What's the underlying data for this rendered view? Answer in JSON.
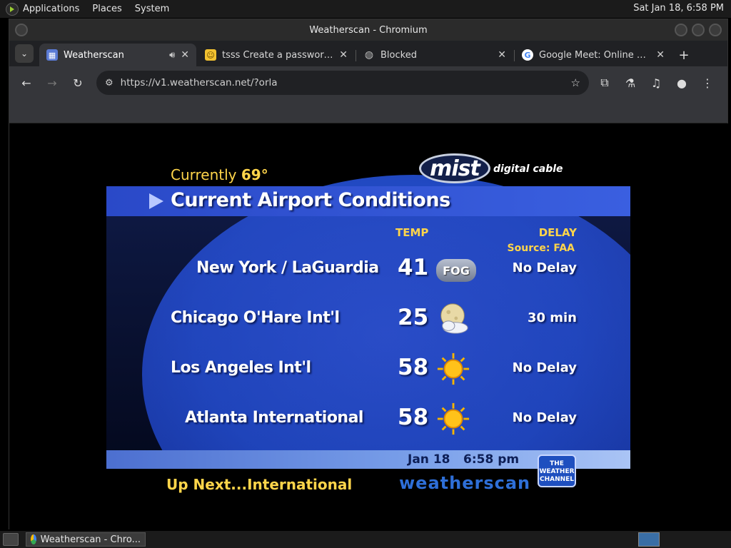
{
  "top_panel": {
    "menus": [
      "Applications",
      "Places",
      "System"
    ],
    "clock": "Sat Jan 18,  6:58 PM"
  },
  "window": {
    "title": "Weatherscan - Chromium"
  },
  "tabs": [
    {
      "title": "Weatherscan",
      "icon": "weatherscan-favicon",
      "audio": true,
      "active": true
    },
    {
      "title": "tsss Create a password-p",
      "icon": "emoji-favicon",
      "active": false
    },
    {
      "title": "Blocked",
      "icon": "globe-favicon",
      "active": false
    },
    {
      "title": "Google Meet: Online Web",
      "icon": "google-favicon",
      "active": false
    }
  ],
  "toolbar": {
    "url": "https://v1.weatherscan.net/?orla"
  },
  "weatherscan": {
    "currently_label": "Currently",
    "currently_temp": "69°",
    "sponsor_logo": "mist",
    "sponsor_tagline": "digital cable",
    "title": "Current Airport Conditions",
    "temp_header": "TEMP",
    "delay_header": "DELAY",
    "source": "Source: FAA",
    "rows": [
      {
        "airport": "New York / LaGuardia",
        "temp": "41",
        "condition": "FOG",
        "icon": "fog-icon",
        "delay": "No Delay"
      },
      {
        "airport": "Chicago O'Hare Int'l",
        "temp": "25",
        "condition": "",
        "icon": "moon-cloud-icon",
        "delay": "30 min"
      },
      {
        "airport": "Los Angeles Int'l",
        "temp": "58",
        "condition": "",
        "icon": "sun-icon",
        "delay": "No Delay"
      },
      {
        "airport": "Atlanta International",
        "temp": "58",
        "condition": "",
        "icon": "sun-icon",
        "delay": "No Delay"
      }
    ],
    "date": "Jan 18",
    "time": "6:58 pm",
    "up_next": "Up Next...International",
    "brand": "weatherscan",
    "twc_logo_text": "THE WEATHER CHANNEL"
  },
  "taskbar": {
    "task_label": "Weatherscan - Chro..."
  },
  "colors": {
    "accent_yellow": "#ffd54a",
    "ws_blue": "#2149c2"
  }
}
